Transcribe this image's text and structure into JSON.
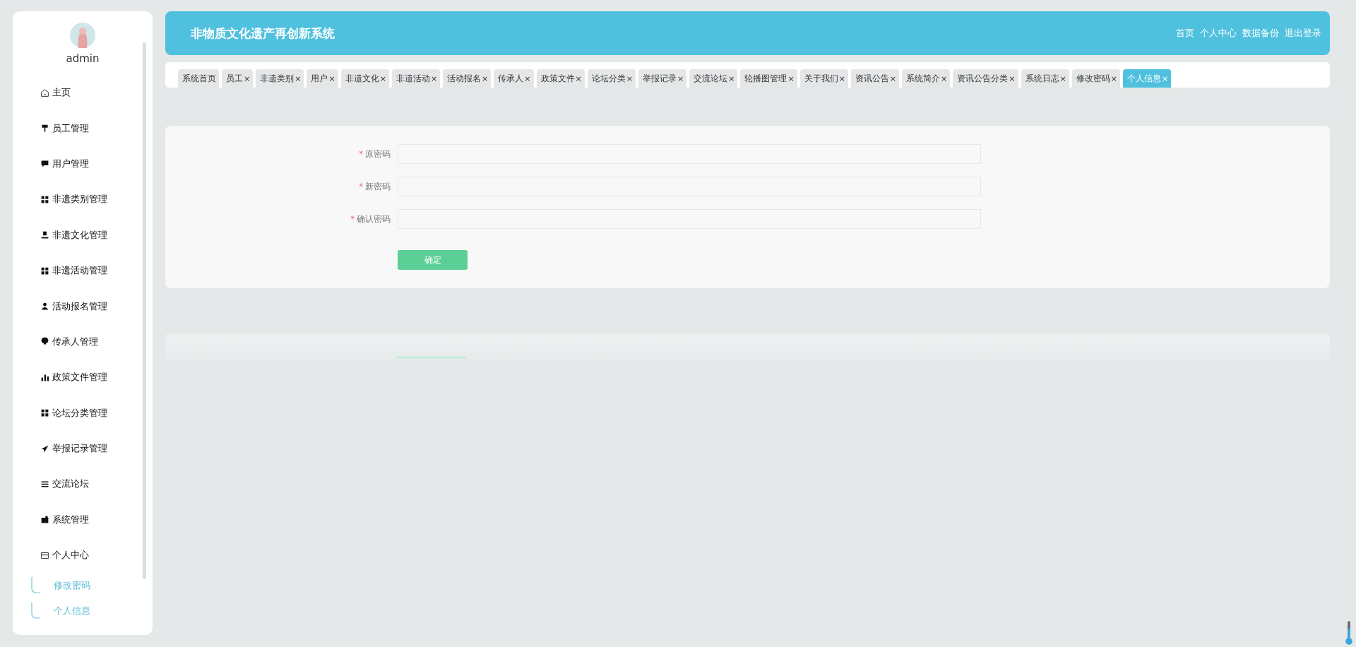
{
  "sidebar": {
    "user": "admin",
    "items": [
      {
        "label": "主页"
      },
      {
        "label": "员工管理"
      },
      {
        "label": "用户管理"
      },
      {
        "label": "非遗类别管理"
      },
      {
        "label": "非遗文化管理"
      },
      {
        "label": "非遗活动管理"
      },
      {
        "label": "活动报名管理"
      },
      {
        "label": "传承人管理"
      },
      {
        "label": "政策文件管理"
      },
      {
        "label": "论坛分类管理"
      },
      {
        "label": "举报记录管理"
      },
      {
        "label": "交流论坛"
      },
      {
        "label": "系统管理"
      },
      {
        "label": "个人中心",
        "expanded": true,
        "children": [
          {
            "label": "修改密码"
          },
          {
            "label": "个人信息"
          }
        ]
      }
    ]
  },
  "header": {
    "title": "非物质文化遗产再创新系统",
    "links": [
      "首页",
      "个人中心",
      "数据备份",
      "退出登录"
    ]
  },
  "tabs": [
    {
      "label": "系统首页",
      "selected": false
    },
    {
      "label": "员工",
      "close": "×",
      "selected": false
    },
    {
      "label": "非遗类别",
      "close": "×",
      "selected": false
    },
    {
      "label": "用户",
      "close": "×",
      "selected": false
    },
    {
      "label": "非遗文化",
      "close": "×",
      "selected": false
    },
    {
      "label": "非遗活动",
      "close": "×",
      "selected": false
    },
    {
      "label": "活动报名",
      "close": "×",
      "selected": false
    },
    {
      "label": "传承人",
      "close": "×",
      "selected": false
    },
    {
      "label": "政策文件",
      "close": "×",
      "selected": false
    },
    {
      "label": "论坛分类",
      "close": "×",
      "selected": false
    },
    {
      "label": "举报记录",
      "close": "×",
      "selected": false
    },
    {
      "label": "交流论坛",
      "close": "×",
      "selected": false
    },
    {
      "label": "轮播图管理",
      "close": "×",
      "selected": false
    },
    {
      "label": "关于我们",
      "close": "×",
      "selected": false
    },
    {
      "label": "资讯公告",
      "close": "×",
      "selected": false
    },
    {
      "label": "系统简介",
      "close": "×",
      "selected": false
    },
    {
      "label": "资讯公告分类",
      "close": "×",
      "selected": false
    },
    {
      "label": "系统日志",
      "close": "×",
      "selected": false
    },
    {
      "label": "修改密码",
      "close": "×",
      "selected": false
    },
    {
      "label": "个人信息",
      "close": "×",
      "selected": true
    }
  ],
  "form": {
    "fields": [
      {
        "label": "原密码",
        "mark": "*"
      },
      {
        "label": "新密码",
        "mark": "*"
      },
      {
        "label": "确认密码",
        "mark": "*"
      }
    ],
    "submit": "确定"
  }
}
